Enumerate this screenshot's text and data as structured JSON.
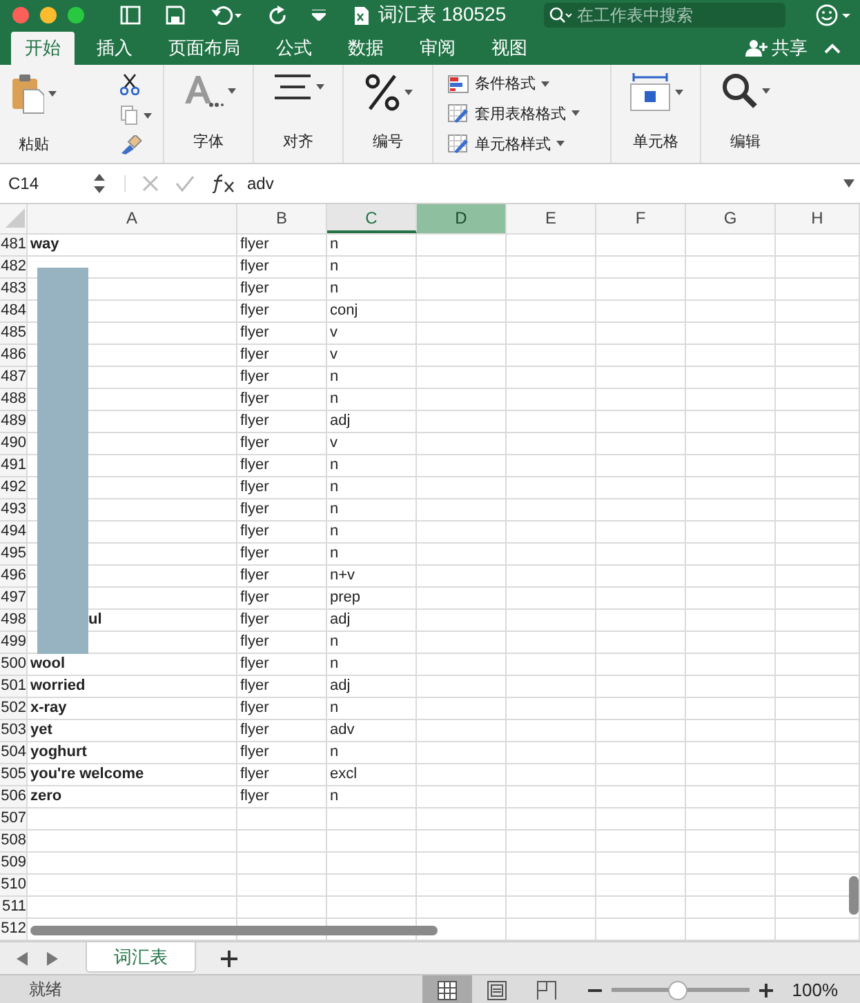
{
  "window": {
    "title": "词汇表 180525",
    "search": {
      "placeholder": "在工作表中搜索"
    }
  },
  "tabs": [
    {
      "label": "开始",
      "selected": true
    },
    {
      "label": "插入",
      "selected": false
    },
    {
      "label": "页面布局",
      "selected": false
    },
    {
      "label": "公式",
      "selected": false
    },
    {
      "label": "数据",
      "selected": false
    },
    {
      "label": "审阅",
      "selected": false
    },
    {
      "label": "视图",
      "selected": false
    }
  ],
  "share": "共享",
  "ribbon": {
    "paste": "粘贴",
    "font": "字体",
    "align": "对齐",
    "number": "编号",
    "styles": [
      "条件格式",
      "套用表格格式",
      "单元格样式"
    ],
    "cells": "单元格",
    "edit": "编辑"
  },
  "formula_bar": {
    "name_box": "C14",
    "formula": "adv"
  },
  "columns": [
    {
      "label": "A",
      "selected": false,
      "current": false
    },
    {
      "label": "B",
      "selected": false,
      "current": false
    },
    {
      "label": "C",
      "selected": false,
      "current": true
    },
    {
      "label": "D",
      "selected": true,
      "current": false
    },
    {
      "label": "E",
      "selected": false,
      "current": false
    },
    {
      "label": "F",
      "selected": false,
      "current": false
    },
    {
      "label": "G",
      "selected": false,
      "current": false
    },
    {
      "label": "H",
      "selected": false,
      "current": false
    }
  ],
  "rows": [
    {
      "num": "481",
      "a": "way",
      "b": "flyer",
      "c": "n"
    },
    {
      "num": "482",
      "b": "flyer",
      "c": "n"
    },
    {
      "num": "483",
      "b": "flyer",
      "c": "n"
    },
    {
      "num": "484",
      "b": "flyer",
      "c": "conj"
    },
    {
      "num": "485",
      "b": "flyer",
      "c": "v"
    },
    {
      "num": "486",
      "b": "flyer",
      "c": "v"
    },
    {
      "num": "487",
      "b": "flyer",
      "c": "n"
    },
    {
      "num": "488",
      "b": "flyer",
      "c": "n"
    },
    {
      "num": "489",
      "b": "flyer",
      "c": "adj"
    },
    {
      "num": "490",
      "b": "flyer",
      "c": "v"
    },
    {
      "num": "491",
      "b": "flyer",
      "c": "n"
    },
    {
      "num": "492",
      "b": "flyer",
      "c": "n"
    },
    {
      "num": "493",
      "b": "flyer",
      "c": "n"
    },
    {
      "num": "494",
      "b": "flyer",
      "c": "n"
    },
    {
      "num": "495",
      "b": "flyer",
      "c": "n"
    },
    {
      "num": "496",
      "b": "flyer",
      "c": "n+v"
    },
    {
      "num": "497",
      "b": "flyer",
      "c": "prep"
    },
    {
      "num": "498",
      "a_tail": "ul",
      "b": "flyer",
      "c": "adj"
    },
    {
      "num": "499",
      "b": "flyer",
      "c": "n"
    },
    {
      "num": "500",
      "a": "wool",
      "b": "flyer",
      "c": "n"
    },
    {
      "num": "501",
      "a": "worried",
      "b": "flyer",
      "c": "adj"
    },
    {
      "num": "502",
      "a": "x-ray",
      "b": "flyer",
      "c": "n"
    },
    {
      "num": "503",
      "a": "yet",
      "b": "flyer",
      "c": "adv"
    },
    {
      "num": "504",
      "a": "yoghurt",
      "b": "flyer",
      "c": "n"
    },
    {
      "num": "505",
      "a": "you're welcome",
      "b": "flyer",
      "c": "excl"
    },
    {
      "num": "506",
      "a": "zero",
      "b": "flyer",
      "c": "n"
    },
    {
      "num": "507"
    },
    {
      "num": "508"
    },
    {
      "num": "509"
    },
    {
      "num": "510"
    },
    {
      "num": "511"
    },
    {
      "num": "512"
    }
  ],
  "sheet_tabs": [
    {
      "label": "词汇表",
      "selected": true
    }
  ],
  "status_bar": {
    "text": "就绪",
    "views": [
      {
        "kind": "normal",
        "selected": true
      },
      {
        "kind": "page",
        "selected": false
      },
      {
        "kind": "break",
        "selected": false
      }
    ],
    "zoom": {
      "level": 0.48,
      "reading": "100%"
    }
  }
}
